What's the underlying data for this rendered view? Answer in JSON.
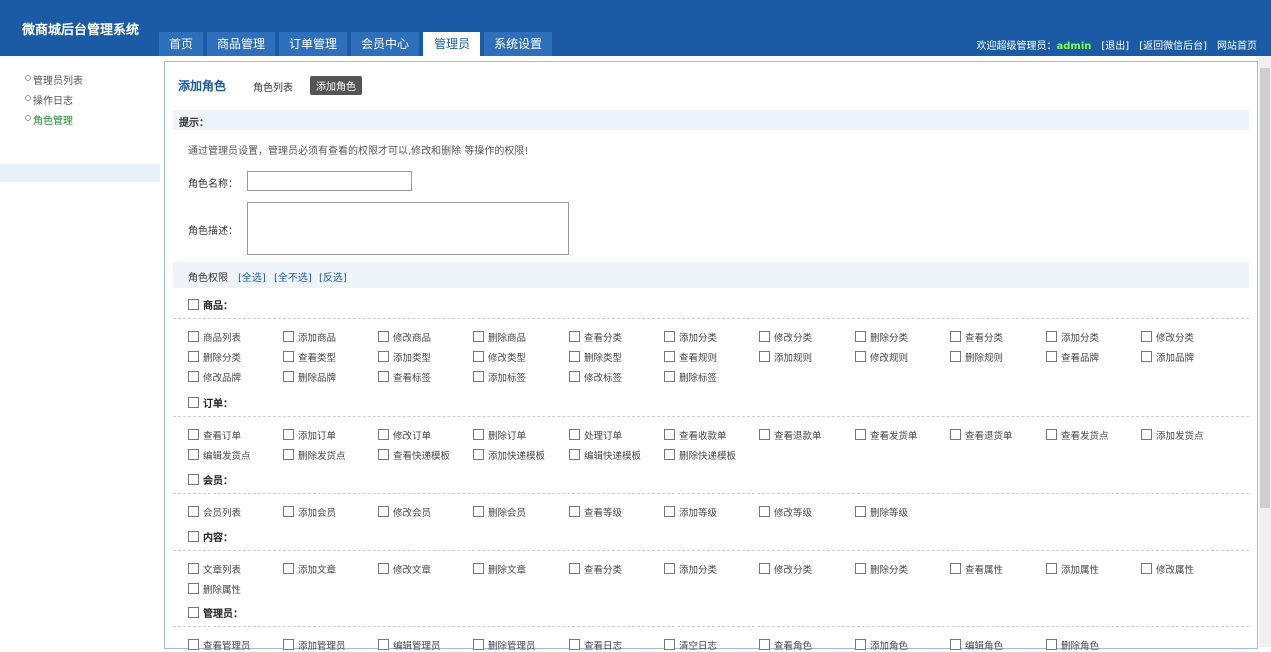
{
  "app": {
    "title": "微商城后台管理系统"
  },
  "nav": {
    "tabs": [
      "首页",
      "商品管理",
      "订单管理",
      "会员中心",
      "管理员",
      "系统设置"
    ],
    "active_index": 4
  },
  "topbar": {
    "welcome": "欢迎超级管理员：",
    "user": "admin",
    "logout": "[退出]",
    "back": "[返回微信后台]",
    "home": "网站首页"
  },
  "sidebar": {
    "items": [
      "管理员列表",
      "操作日志",
      "角色管理"
    ],
    "active_index": 2
  },
  "page": {
    "title": "添加角色",
    "tab_list": "角色列表",
    "tab_add": "添加角色",
    "hint_title": "提示：",
    "hint_text": "通过管理员设置，管理员必须有查看的权限才可以,修改和删除 等操作的权限!",
    "role_name_label": "角色名称：",
    "role_desc_label": "角色描述：",
    "perm_label": "角色权限",
    "perm_select_all": "[全选]",
    "perm_select_none": "[全不选]",
    "perm_invert": "[反选]"
  },
  "groups": [
    {
      "name": "商品：",
      "items": [
        "商品列表",
        "添加商品",
        "修改商品",
        "删除商品",
        "查看分类",
        "添加分类",
        "修改分类",
        "删除分类",
        "查看分类",
        "添加分类",
        "修改分类",
        "删除分类",
        "查看类型",
        "添加类型",
        "修改类型",
        "删除类型",
        "查看规则",
        "添加规则",
        "修改规则",
        "删除规则",
        "查看品牌",
        "添加品牌",
        "修改品牌",
        "删除品牌",
        "查看标签",
        "添加标签",
        "修改标签",
        "删除标签"
      ]
    },
    {
      "name": "订单：",
      "items": [
        "查看订单",
        "添加订单",
        "修改订单",
        "删除订单",
        "处理订单",
        "查看收款单",
        "查看退款单",
        "查看发货单",
        "查看退货单",
        "查看发货点",
        "添加发货点",
        "编辑发货点",
        "删除发货点",
        "查看快递模板",
        "添加快递模板",
        "编辑快递模板",
        "删除快递模板"
      ]
    },
    {
      "name": "会员：",
      "items": [
        "会员列表",
        "添加会员",
        "修改会员",
        "删除会员",
        "查看等级",
        "添加等级",
        "修改等级",
        "删除等级"
      ]
    },
    {
      "name": "内容：",
      "items": [
        "文章列表",
        "添加文章",
        "修改文章",
        "删除文章",
        "查看分类",
        "添加分类",
        "修改分类",
        "删除分类",
        "查看属性",
        "添加属性",
        "修改属性",
        "删除属性"
      ]
    },
    {
      "name": "管理员：",
      "items": [
        "查看管理员",
        "添加管理员",
        "编辑管理员",
        "删除管理员",
        "查看日志",
        "清空日志",
        "查看角色",
        "添加角色",
        "编辑角色",
        "删除角色"
      ]
    }
  ]
}
